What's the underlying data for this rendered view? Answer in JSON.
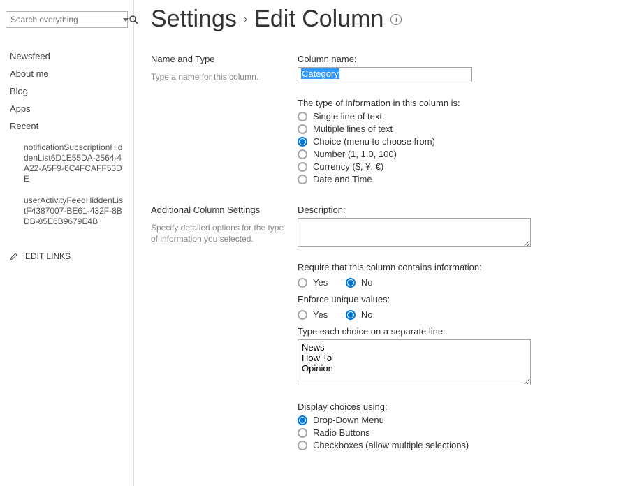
{
  "search": {
    "placeholder": "Search everything"
  },
  "nav": {
    "items": [
      {
        "label": "Newsfeed"
      },
      {
        "label": "About me"
      },
      {
        "label": "Blog"
      },
      {
        "label": "Apps"
      },
      {
        "label": "Recent"
      }
    ],
    "recent_children": [
      "notificationSubscriptionHiddenList6D1E55DA-2564-4A22-A5F9-6C4FCAFF53DE",
      "userActivityFeedHiddenListF4387007-BE61-432F-8BDB-85E6B9679E4B"
    ],
    "edit_links": "EDIT LINKS"
  },
  "title": {
    "root": "Settings",
    "current": "Edit Column"
  },
  "section_name": {
    "heading": "Name and Type",
    "sub": "Type a name for this column.",
    "field_label": "Column name:",
    "field_value": "Category",
    "type_intro": "The type of information in this column is:",
    "types": [
      "Single line of text",
      "Multiple lines of text",
      "Choice (menu to choose from)",
      "Number (1, 1.0, 100)",
      "Currency ($, ¥, €)",
      "Date and Time"
    ],
    "type_selected_index": 2
  },
  "section_add": {
    "heading": "Additional Column Settings",
    "sub": "Specify detailed options for the type of information you selected.",
    "description_label": "Description:",
    "description_value": "",
    "require_label": "Require that this column contains information:",
    "require_yes": "Yes",
    "require_no": "No",
    "require_value": "No",
    "unique_label": "Enforce unique values:",
    "unique_yes": "Yes",
    "unique_no": "No",
    "unique_value": "No",
    "choices_label": "Type each choice on a separate line:",
    "choices_value": "News\nHow To\nOpinion",
    "display_label": "Display choices using:",
    "display_options": [
      "Drop-Down Menu",
      "Radio Buttons",
      "Checkboxes (allow multiple selections)"
    ],
    "display_selected_index": 0
  }
}
